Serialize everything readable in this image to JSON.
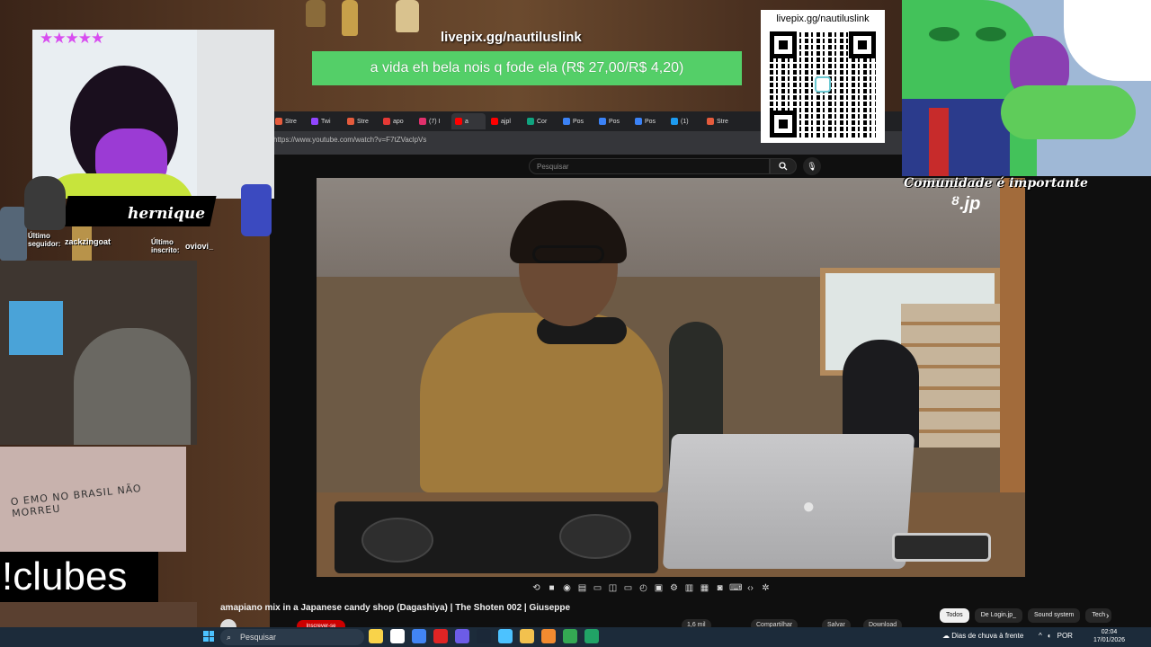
{
  "overlay": {
    "pix_link": "livepix.gg/nautiluslink",
    "donation_message": "a vida eh bela nois q fode ela (R$ 27,00/R$ 4,20)",
    "qr_label": "livepix.gg/nautiluslink",
    "community_caption": "Comunidade é importante",
    "streamer_name": "hernique",
    "last_follower_label": "Último seguidor:",
    "last_follower_value": "zackzingoat",
    "last_sub_label": "Último inscrito:",
    "last_sub_value": "oviovi_",
    "rating_stars": "★★★★★",
    "command_text": "!clubes",
    "graffiti_text": "O EMO NO BRASIL NÃO MORREU"
  },
  "browser": {
    "tabs": [
      {
        "label": "Stre",
        "color": "#e55b3c"
      },
      {
        "label": "Twi",
        "color": "#9146ff"
      },
      {
        "label": "Stre",
        "color": "#e55b3c"
      },
      {
        "label": "apo",
        "color": "#e53935"
      },
      {
        "label": "(7) I",
        "color": "#e1306c"
      },
      {
        "label": "a",
        "color": "#ff0000"
      },
      {
        "label": "ajpl",
        "color": "#ff0000"
      },
      {
        "label": "Cor",
        "color": "#10a37f"
      },
      {
        "label": "Pos",
        "color": "#3b82f6"
      },
      {
        "label": "Pos",
        "color": "#3b82f6"
      },
      {
        "label": "Pos",
        "color": "#3b82f6"
      },
      {
        "label": "(1)",
        "color": "#1d9bf0"
      },
      {
        "label": "Stre",
        "color": "#e55b3c"
      }
    ],
    "address": "https://www.youtube.com/watch?v=F7tZVaclpVs",
    "search_placeholder": "Pesquisar"
  },
  "video": {
    "logo_text": "ᴽ.jp",
    "title": "amapiano mix in a Japanese candy shop (Dagashiya) | The Shoten 002 | Giuseppe",
    "subscribe_label": "Inscrever-se",
    "actions": [
      "1,6 mil",
      "Compartilhar",
      "Salvar",
      "Download"
    ],
    "chips": [
      "Todos",
      "De Login.jp_",
      "Sound system",
      "Tech"
    ]
  },
  "taskbar": {
    "search_placeholder": "Pesquisar",
    "weather": "Dias de chuva à frente",
    "language": "POR",
    "time": "02:04",
    "date": "17/01/2026",
    "app_colors": [
      "#f9d34a",
      "#ffffff",
      "#4285f4",
      "#e02424",
      "#6c5ce7",
      "#1b2838",
      "#4cc2ff",
      "#f2c14e",
      "#f28b30",
      "#34a853",
      "#21a366"
    ]
  },
  "colors": {
    "donation_bg": "#54cf68",
    "youtube_red": "#cc0000",
    "accent_purple": "#d84df0"
  }
}
